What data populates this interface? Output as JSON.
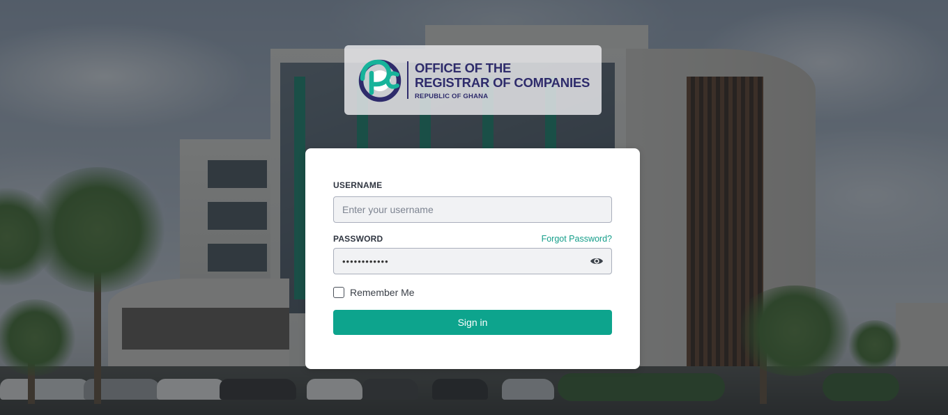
{
  "logo": {
    "line1": "OFFICE OF THE",
    "line2": "REGISTRAR OF COMPANIES",
    "line3": "REPUBLIC OF GHANA",
    "icon": "orc-emblem-icon",
    "colors": {
      "navy": "#2e2b6b",
      "teal": "#17b39a"
    }
  },
  "form": {
    "username": {
      "label": "USERNAME",
      "placeholder": "Enter your username",
      "value": ""
    },
    "password": {
      "label": "PASSWORD",
      "value": "••••••••••••",
      "forgot_link": "Forgot Password?",
      "toggle_icon": "eye-icon"
    },
    "remember": {
      "label": "Remember Me",
      "checked": false
    },
    "submit_label": "Sign in"
  },
  "colors": {
    "accent": "#0da48d",
    "link": "#159e8a",
    "card": "#ffffff"
  }
}
